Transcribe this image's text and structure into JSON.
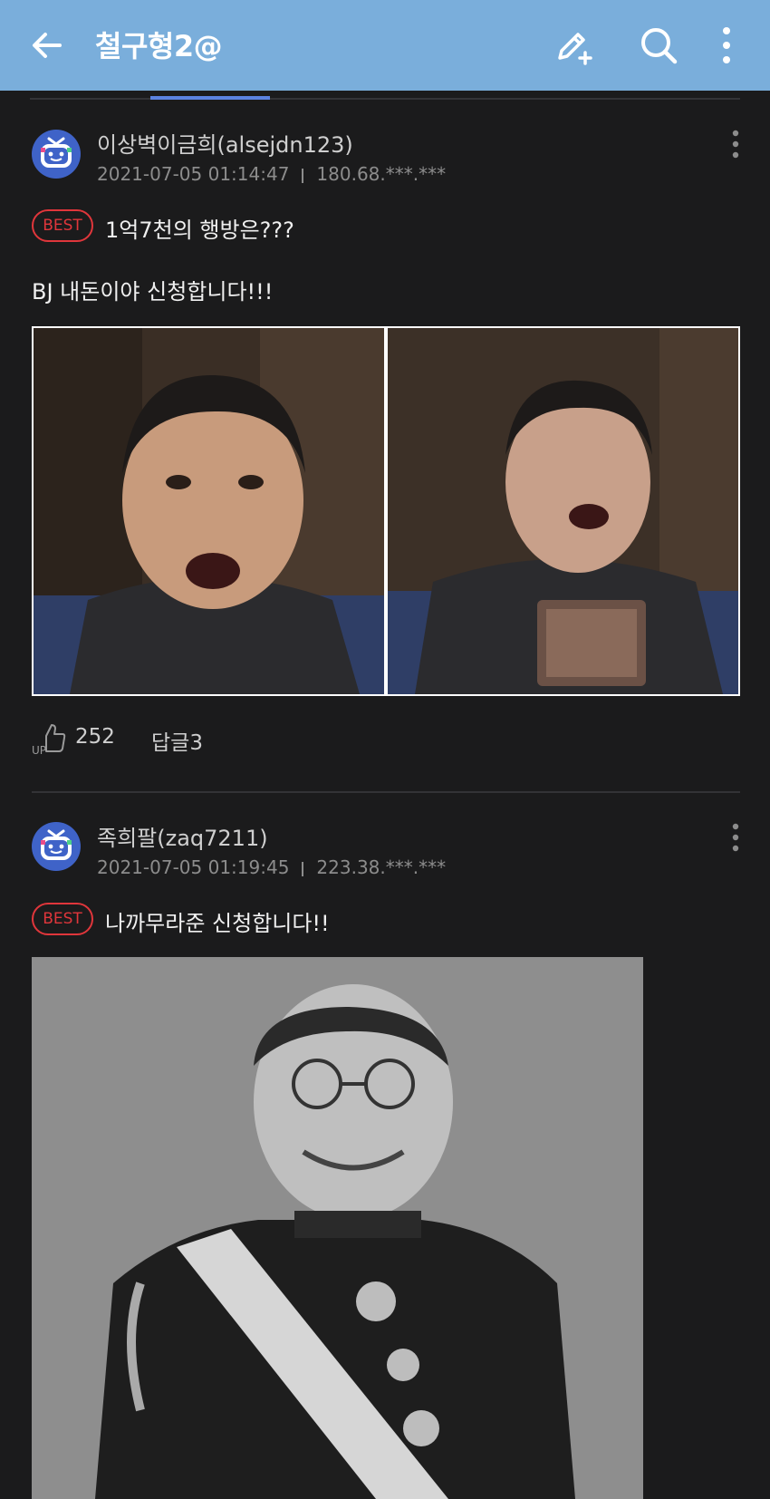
{
  "appbar": {
    "title": "철구형2@",
    "back_icon": "arrow-left-icon",
    "write_icon": "pencil-plus-icon",
    "search_icon": "search-icon",
    "more_icon": "more-vertical-icon",
    "background": "#7aaedb"
  },
  "tabs": {
    "indicator_color": "#5b82e0"
  },
  "comments": [
    {
      "author": "이상벽이금희(alsejdn123)",
      "date": "2021-07-05 01:14:47",
      "ip": "180.68.***.***",
      "badge": "BEST",
      "title": "1억7천의 행방은???",
      "body": "BJ 내돈이야 신청합니다!!!",
      "up_label": "UP",
      "up_count": "252",
      "reply_label": "답글3"
    },
    {
      "author": "족희팔(zaq7211)",
      "date": "2021-07-05 01:19:45",
      "ip": "223.38.***.***",
      "badge": "BEST",
      "title": "나까무라준 신청합니다!!"
    }
  ],
  "colors": {
    "background": "#1b1b1c",
    "best_red": "#e0363b",
    "text": "#f0f0f0",
    "meta": "#8c8c8c"
  }
}
